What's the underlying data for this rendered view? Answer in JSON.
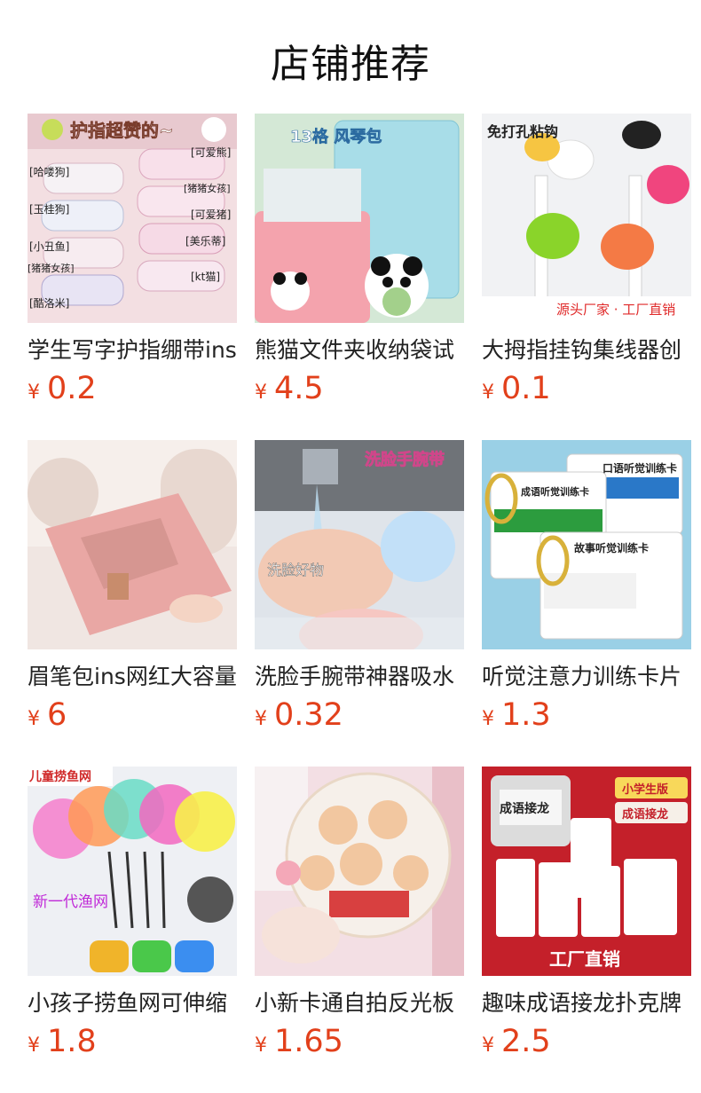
{
  "header": {
    "title": "店铺推荐"
  },
  "currency_symbol": "¥",
  "products": [
    {
      "title": "学生写字护指绷带ins",
      "price": "0.2",
      "overlay": "护指超赞的~",
      "tags": [
        "[哈喽狗]",
        "[玉桂狗]",
        "[小丑鱼]",
        "[猪猪女孩]",
        "[酷洛米]",
        "[可爱熊]",
        "[猪猪女孩]",
        "[可爱猪]",
        "[美乐蒂]",
        "[kt猫]"
      ]
    },
    {
      "title": "熊猫文件夹收纳袋试",
      "price": "4.5",
      "overlay": "13格 风琴包"
    },
    {
      "title": "大拇指挂钩集线器创",
      "price": "0.1",
      "overlay": "免打孔粘钩",
      "footer": "源头厂家 · 工厂直销"
    },
    {
      "title": "眉笔包ins网红大容量",
      "price": "6"
    },
    {
      "title": "洗脸手腕带神器吸水",
      "price": "0.32",
      "overlay": "洗脸手腕带",
      "sub": "洗脸好物"
    },
    {
      "title": "听觉注意力训练卡片",
      "price": "1.3",
      "cards": [
        "口语听觉训练卡",
        "成语听觉训练卡",
        "故事听觉训练卡"
      ]
    },
    {
      "title": "小孩子捞鱼网可伸缩",
      "price": "1.8",
      "overlay": "儿童捞鱼网",
      "sub": "新一代渔网"
    },
    {
      "title": "小新卡通自拍反光板",
      "price": "1.65"
    },
    {
      "title": "趣味成语接龙扑克牌",
      "price": "2.5",
      "badge1": "小学生版",
      "badge2": "成语接龙",
      "box": "成语接龙",
      "footer": "工厂直销"
    }
  ]
}
